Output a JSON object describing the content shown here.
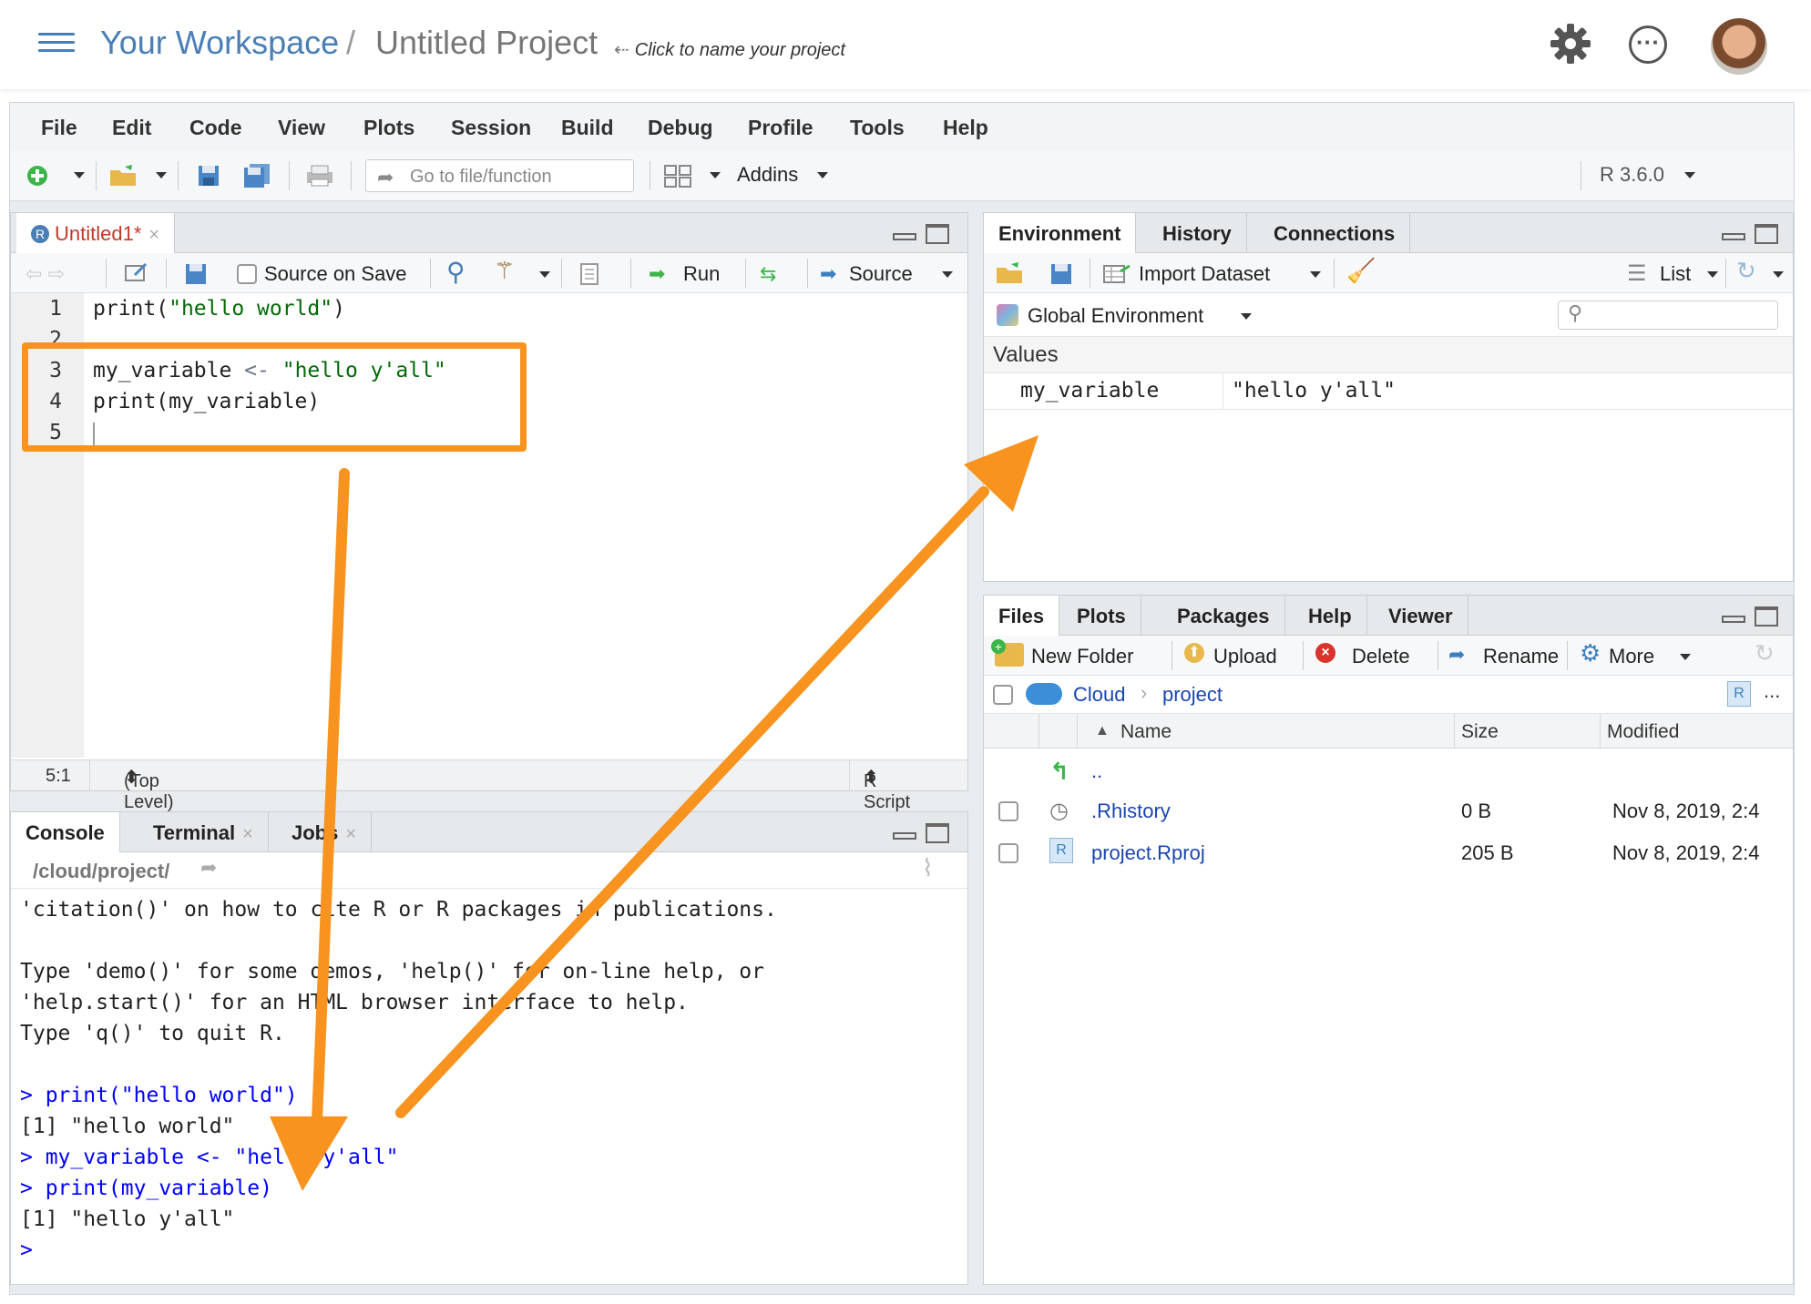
{
  "workspace": {
    "workspace_name": "Your Workspace",
    "separator": "/",
    "project_name": "Untitled Project",
    "project_hint": "Click to name your project"
  },
  "menu": [
    "File",
    "Edit",
    "Code",
    "View",
    "Plots",
    "Session",
    "Build",
    "Debug",
    "Profile",
    "Tools",
    "Help"
  ],
  "toolbar": {
    "goto_placeholder": "Go to file/function",
    "addins_label": "Addins",
    "r_version": "R 3.6.0"
  },
  "editor": {
    "tab_name": "Untitled1*",
    "source_on_save": "Source on Save",
    "run_label": "Run",
    "source_label": "Source",
    "lines": [
      "1",
      "2",
      "3",
      "4",
      "5"
    ],
    "code": {
      "l1_fn": "print(",
      "l1_str": "\"hello world\"",
      "l1_end": ")",
      "l3_var": "my_variable ",
      "l3_op": "<-",
      "l3_str": " \"hello y'all\"",
      "l4": "print(my_variable)"
    },
    "status": {
      "position": "5:1",
      "scope": "(Top Level)",
      "file_type": "R Script"
    }
  },
  "console": {
    "tabs": [
      "Console",
      "Terminal",
      "Jobs"
    ],
    "path": "/cloud/project/",
    "lines": [
      {
        "text": "'citation()' on how to cite R or R packages in publications.",
        "kind": "out"
      },
      {
        "text": "",
        "kind": "out"
      },
      {
        "text": "Type 'demo()' for some demos, 'help()' for on-line help, or",
        "kind": "out"
      },
      {
        "text": "'help.start()' for an HTML browser interface to help.",
        "kind": "out"
      },
      {
        "text": "Type 'q()' to quit R.",
        "kind": "out"
      },
      {
        "text": "",
        "kind": "out"
      },
      {
        "text": "> print(\"hello world\")",
        "kind": "cmd"
      },
      {
        "text": "[1] \"hello world\"",
        "kind": "out"
      },
      {
        "text": "> my_variable <- \"hello y'all\"",
        "kind": "cmd"
      },
      {
        "text": "> print(my_variable)",
        "kind": "cmd"
      },
      {
        "text": "[1] \"hello y'all\"",
        "kind": "out"
      },
      {
        "text": "> ",
        "kind": "cmd"
      }
    ]
  },
  "environment": {
    "tabs": [
      "Environment",
      "History",
      "Connections"
    ],
    "import_dataset": "Import Dataset",
    "list_label": "List",
    "scope": "Global Environment",
    "section": "Values",
    "rows": [
      {
        "name": "my_variable",
        "value": "\"hello y'all\""
      }
    ]
  },
  "files": {
    "tabs": [
      "Files",
      "Plots",
      "Packages",
      "Help",
      "Viewer"
    ],
    "actions": {
      "new_folder": "New Folder",
      "upload": "Upload",
      "delete": "Delete",
      "rename": "Rename",
      "more": "More"
    },
    "breadcrumb": {
      "root": "Cloud",
      "folder": "project"
    },
    "ellipsis": "...",
    "columns": {
      "name": "Name",
      "size": "Size",
      "modified": "Modified"
    },
    "parent": "..",
    "rows": [
      {
        "name": ".Rhistory",
        "size": "0 B",
        "modified": "Nov 8, 2019, 2:4"
      },
      {
        "name": "project.Rproj",
        "size": "205 B",
        "modified": "Nov 8, 2019, 2:4"
      }
    ]
  },
  "colors": {
    "annotation": "#f7931e",
    "link": "#1b45b0",
    "console_cmd": "#0000ff",
    "string": "#036a07",
    "workspace_blue": "#4a7fb5"
  }
}
